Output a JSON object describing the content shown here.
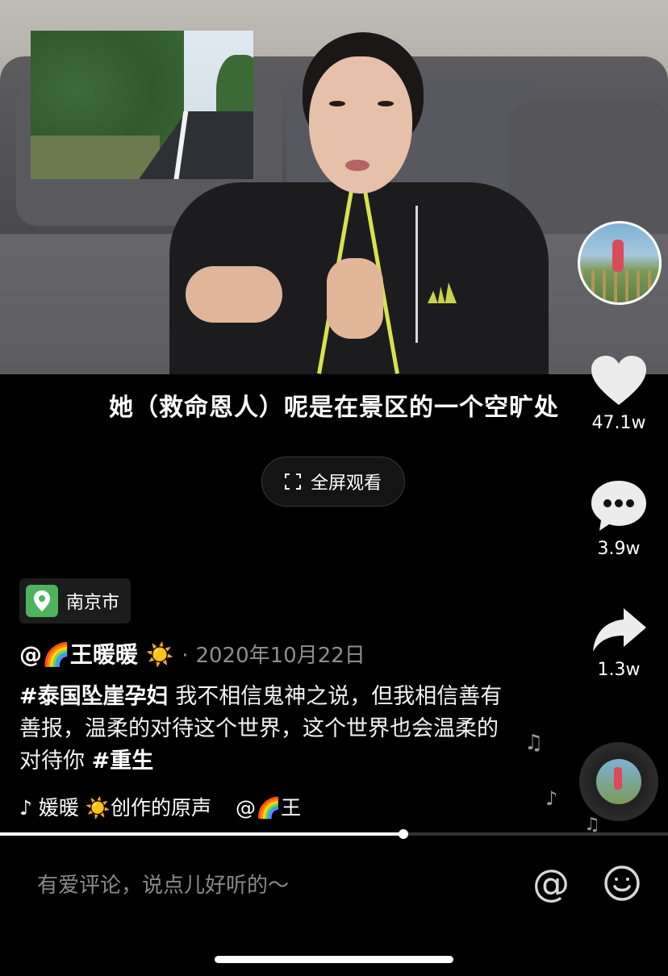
{
  "video": {
    "subtitle": "她（救命恩人）呢是在景区的一个空旷处"
  },
  "fullscreen": {
    "label": "全屏观看"
  },
  "actions": {
    "like_count": "47.1w",
    "comment_count": "3.9w",
    "share_count": "1.3w"
  },
  "location": {
    "label": "南京市"
  },
  "author": {
    "prefix": "@🌈",
    "name": "王暖暖",
    "emoji": "☀️",
    "separator": "·",
    "date": "2020年10月22日"
  },
  "description": {
    "hashtag1": "#泰国坠崖孕妇",
    "text": " 我不相信鬼神之说，但我相信善有善报，温柔的对待这个世界，这个世界也会温柔的对待你 ",
    "hashtag2": "#重生"
  },
  "music": {
    "title": "媛暖 ☀️创作的原声",
    "author": "@🌈王"
  },
  "progress": {
    "fraction": 0.604
  },
  "comment_bar": {
    "placeholder": "有爱评论，说点儿好听的～",
    "at_symbol": "@"
  },
  "icons": [
    "fullscreen-icon",
    "heart-icon",
    "comment-icon",
    "share-icon",
    "location-pin-icon",
    "tiktok-note-icon",
    "music-disc-icon",
    "at-icon",
    "emoji-icon"
  ],
  "colors": {
    "background": "#000000",
    "location_pin": "#4fb35e",
    "secondary_text": "#8e8e8e"
  }
}
